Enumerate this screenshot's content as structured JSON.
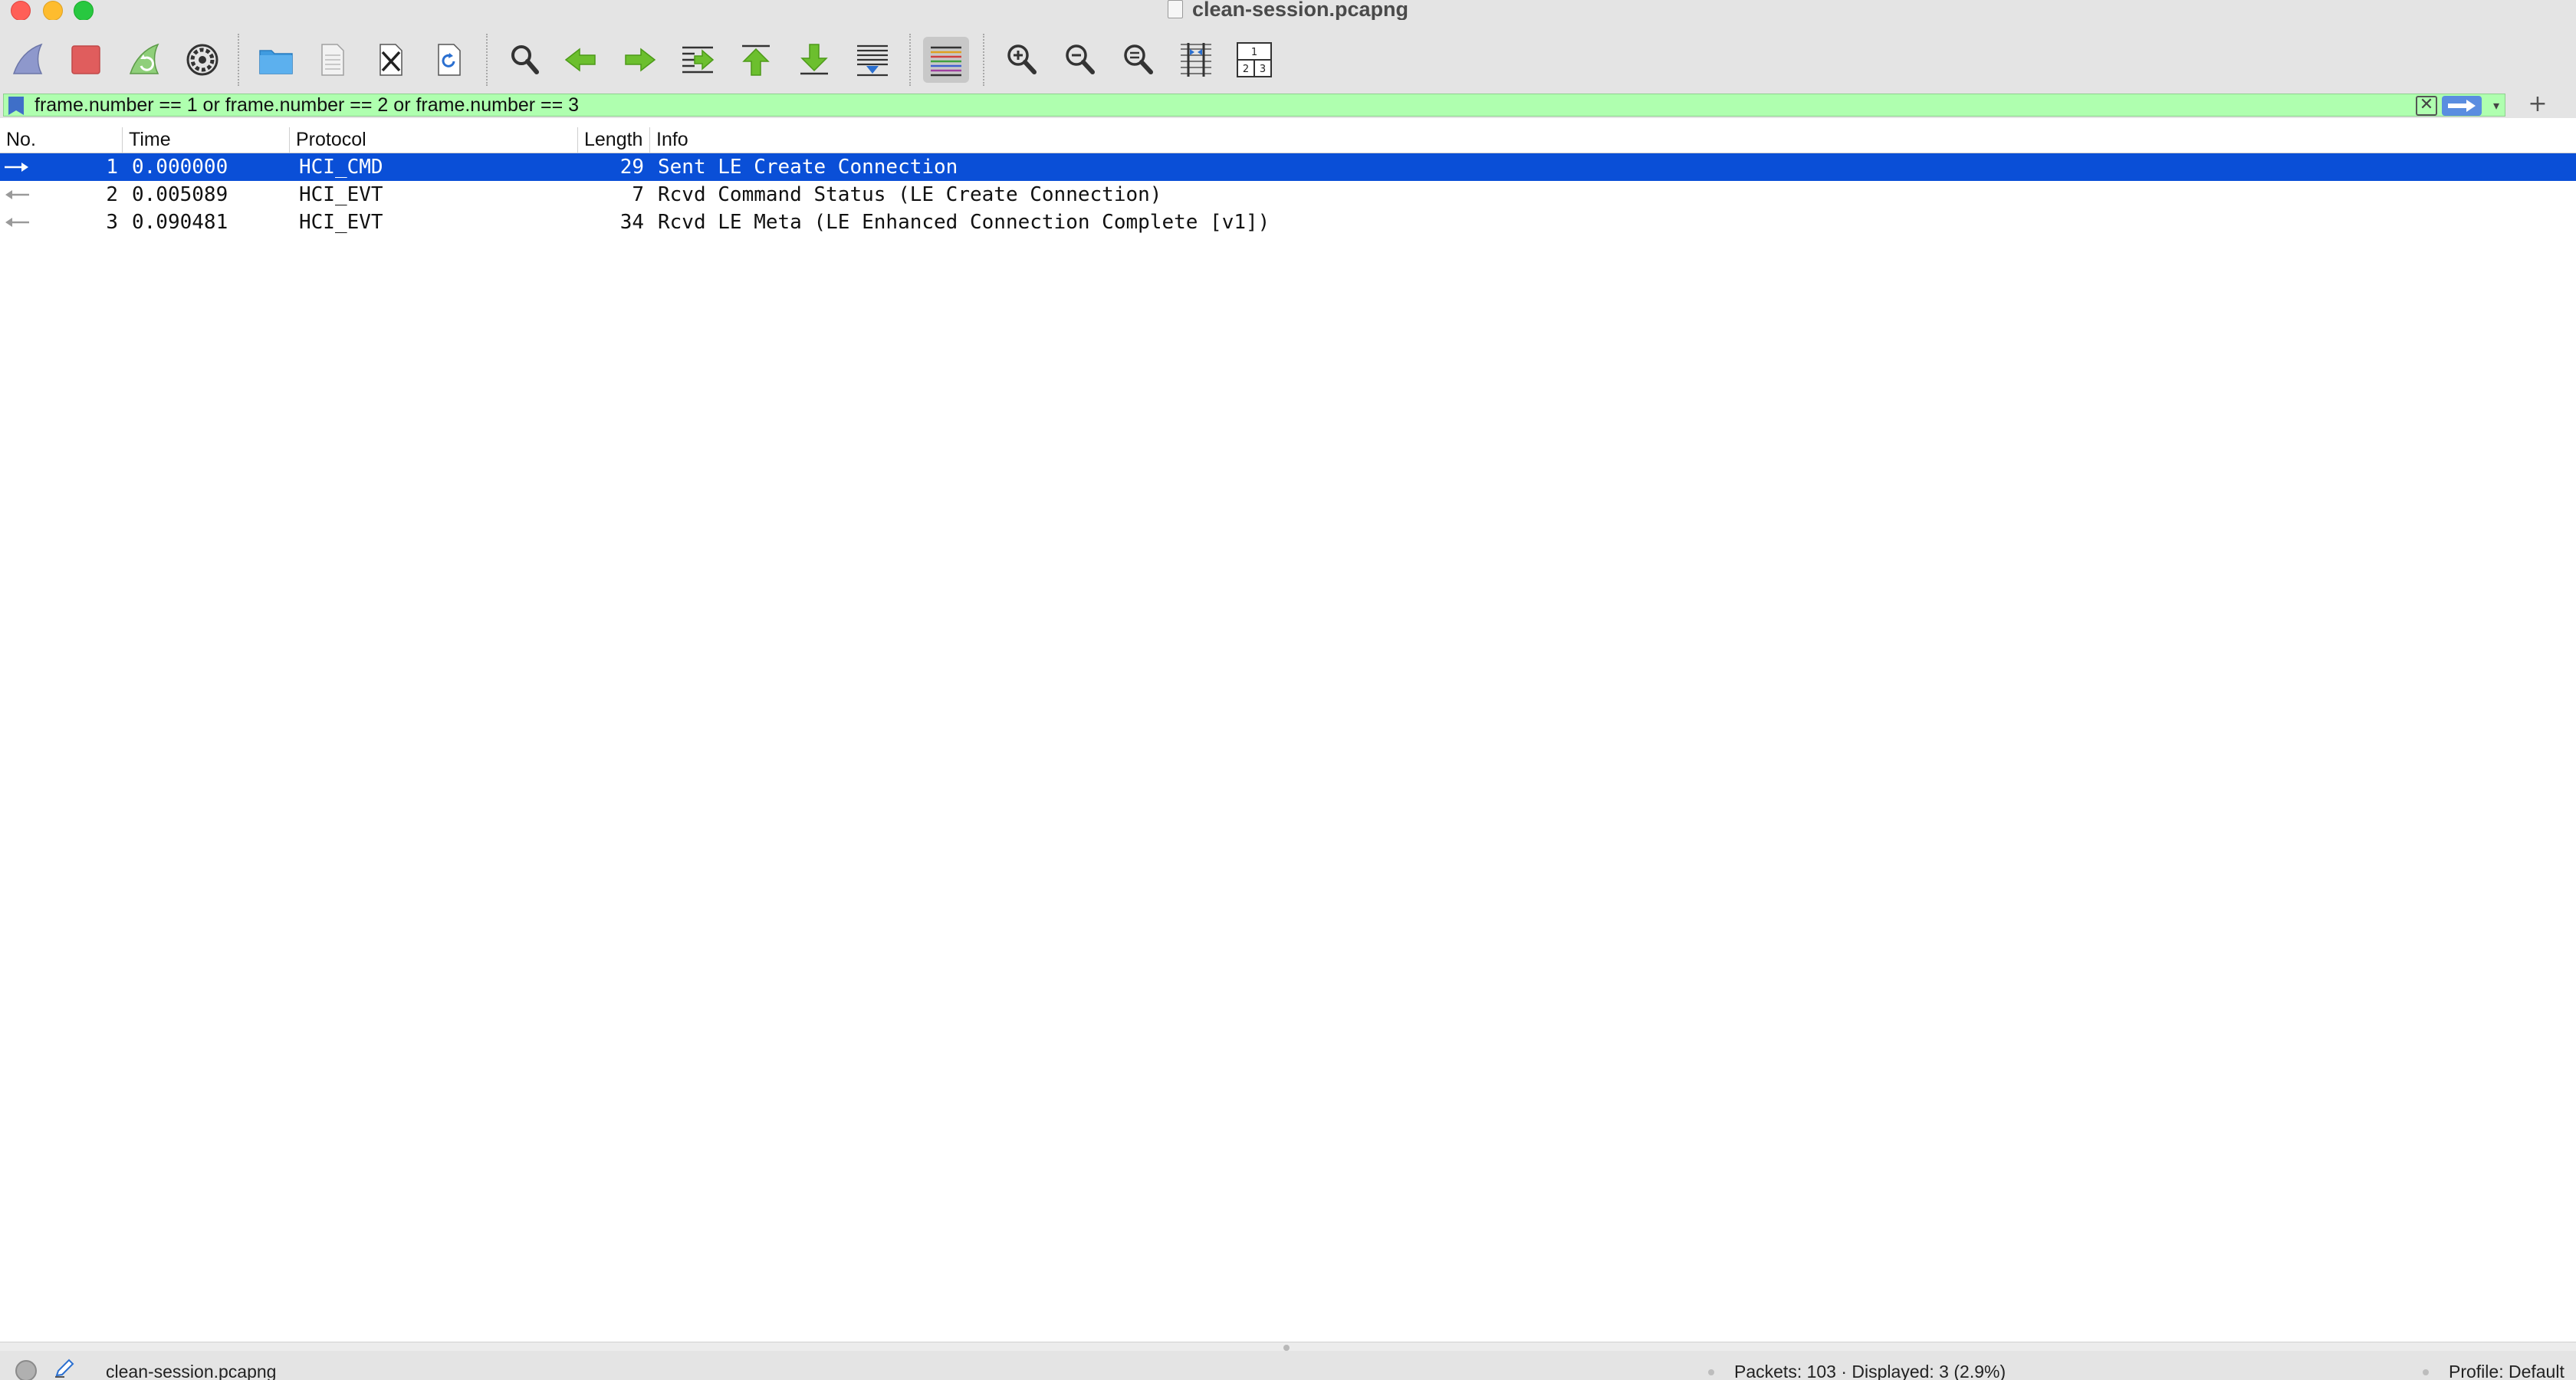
{
  "window": {
    "title": "clean-session.pcapng"
  },
  "toolbar": {
    "buttons": [
      {
        "name": "start-capture",
        "icon": "shark-fin-icon"
      },
      {
        "name": "stop-capture",
        "icon": "stop-square-icon"
      },
      {
        "name": "restart-capture",
        "icon": "shark-fin-restart-icon"
      },
      {
        "name": "capture-options",
        "icon": "gear-icon"
      },
      {
        "name": "open-file",
        "icon": "folder-icon"
      },
      {
        "name": "save-file",
        "icon": "document-icon"
      },
      {
        "name": "close-file",
        "icon": "document-close-icon"
      },
      {
        "name": "reload-file",
        "icon": "document-reload-icon"
      },
      {
        "name": "find-packet",
        "icon": "magnifier-icon"
      },
      {
        "name": "go-back",
        "icon": "arrow-left-icon"
      },
      {
        "name": "go-forward",
        "icon": "arrow-right-icon"
      },
      {
        "name": "go-to-packet",
        "icon": "jump-to-icon"
      },
      {
        "name": "go-first",
        "icon": "arrow-top-icon"
      },
      {
        "name": "go-last",
        "icon": "arrow-bottom-icon"
      },
      {
        "name": "auto-scroll",
        "icon": "autoscroll-icon"
      },
      {
        "name": "colorize",
        "icon": "colorize-lines-icon"
      },
      {
        "name": "zoom-in",
        "icon": "zoom-in-icon"
      },
      {
        "name": "zoom-out",
        "icon": "zoom-out-icon"
      },
      {
        "name": "zoom-reset",
        "icon": "zoom-reset-icon"
      },
      {
        "name": "resize-columns",
        "icon": "resize-columns-icon"
      },
      {
        "name": "layout",
        "icon": "pane-layout-icon"
      }
    ],
    "layout_labels": [
      "1",
      "2",
      "3"
    ]
  },
  "filter": {
    "value": "frame.number == 1 or frame.number == 2 or frame.number == 3",
    "clear_glyph": "✕",
    "dropdown_glyph": "▾",
    "add_glyph": "+"
  },
  "packet_list": {
    "columns": [
      "No.",
      "Time",
      "Protocol",
      "Length",
      "Info"
    ],
    "rows": [
      {
        "no": "1",
        "time": "0.000000",
        "protocol": "HCI_CMD",
        "length": "29",
        "info": "Sent LE Create Connection",
        "direction": "sent",
        "selected": true
      },
      {
        "no": "2",
        "time": "0.005089",
        "protocol": "HCI_EVT",
        "length": "7",
        "info": "Rcvd Command Status (LE Create Connection)",
        "direction": "received",
        "selected": false
      },
      {
        "no": "3",
        "time": "0.090481",
        "protocol": "HCI_EVT",
        "length": "34",
        "info": "Rcvd LE Meta (LE Enhanced Connection Complete [v1])",
        "direction": "received",
        "selected": false
      }
    ]
  },
  "status": {
    "file": "clean-session.pcapng",
    "packets": "Packets: 103 · Displayed: 3 (2.9%)",
    "profile": "Profile: Default"
  },
  "colors": {
    "selected_row": "#0a4fd7",
    "filter_valid": "#afffaf",
    "chrome": "#e4e4e4"
  }
}
